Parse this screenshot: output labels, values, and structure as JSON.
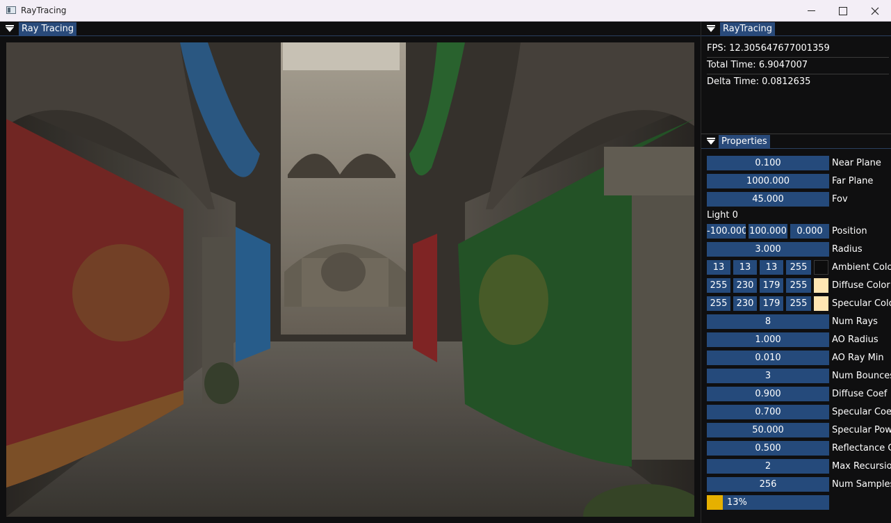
{
  "window": {
    "title": "RayTracing"
  },
  "raytracing_panel": {
    "tab": "Ray Tracing"
  },
  "stats_panel": {
    "tab": "RayTracing",
    "fps": "FPS: 12.305647677001359",
    "total_time": "Total Time: 6.9047007",
    "delta_time": "Delta Time: 0.0812635"
  },
  "properties": {
    "tab": "Properties",
    "near_plane": {
      "value": "0.100",
      "label": "Near Plane"
    },
    "far_plane": {
      "value": "1000.000",
      "label": "Far Plane"
    },
    "fov": {
      "value": "45.000",
      "label": "Fov"
    },
    "light_header": "Light 0",
    "position": {
      "x": "-100.000",
      "y": "100.000",
      "z": "0.000",
      "label": "Position"
    },
    "radius": {
      "value": "3.000",
      "label": "Radius"
    },
    "ambient": {
      "r": "13",
      "g": "13",
      "b": "13",
      "a": "255",
      "label": "Ambient Colo",
      "swatch": "#0d0d0d"
    },
    "diffuse": {
      "r": "255",
      "g": "230",
      "b": "179",
      "a": "255",
      "label": "Diffuse Color",
      "swatch": "#ffe6b3"
    },
    "specular": {
      "r": "255",
      "g": "230",
      "b": "179",
      "a": "255",
      "label": "Specular Colc",
      "swatch": "#ffe6b3"
    },
    "num_rays": {
      "value": "8",
      "label": "Num Rays"
    },
    "ao_radius": {
      "value": "1.000",
      "label": "AO Radius"
    },
    "ao_ray_min": {
      "value": "0.010",
      "label": "AO Ray Min"
    },
    "num_bounces": {
      "value": "3",
      "label": "Num Bounces"
    },
    "diffuse_coef": {
      "value": "0.900",
      "label": "Diffuse Coef"
    },
    "specular_coef": {
      "value": "0.700",
      "label": "Specular Coef"
    },
    "specular_power": {
      "value": "50.000",
      "label": "Specular Pow"
    },
    "reflectance": {
      "value": "0.500",
      "label": "Reflectance C"
    },
    "max_recursion": {
      "value": "2",
      "label": "Max Recursio"
    },
    "num_samples": {
      "value": "256",
      "label": "Num Samples"
    },
    "progress": {
      "text": "13%",
      "fraction": 0.13
    }
  },
  "colors": {
    "accent": "#254a7b",
    "tab": "#294a7a",
    "progress_fill": "#e6b000"
  }
}
